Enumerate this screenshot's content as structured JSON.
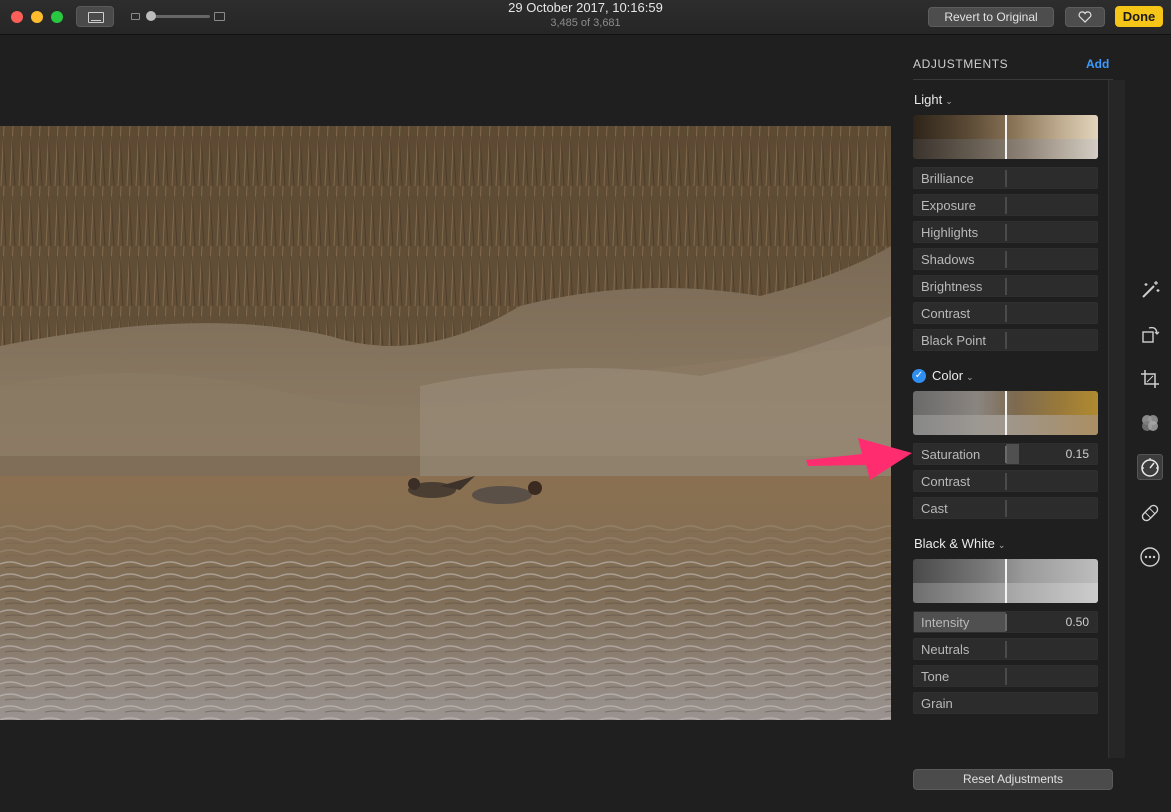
{
  "window": {
    "title_date": "29 October 2017, 10:16:59",
    "title_count": "3,485 of 3,681",
    "revert_label": "Revert to Original",
    "done_label": "Done",
    "favorite_icon": "heart-icon"
  },
  "adjustments": {
    "header": "ADJUSTMENTS",
    "add_label": "Add",
    "light": {
      "title": "Light",
      "sliders": [
        "Brilliance",
        "Exposure",
        "Highlights",
        "Shadows",
        "Brightness",
        "Contrast",
        "Black Point"
      ]
    },
    "color": {
      "title": "Color",
      "enabled": true,
      "saturation": {
        "label": "Saturation",
        "value": "0.15"
      },
      "contrast": "Contrast",
      "cast": "Cast"
    },
    "bw": {
      "title": "Black & White",
      "intensity": {
        "label": "Intensity",
        "value": "0.50"
      },
      "neutrals": "Neutrals",
      "tone": "Tone",
      "grain": "Grain"
    },
    "reset_label": "Reset Adjustments"
  },
  "tools": [
    "magic-wand-icon",
    "rotate-icon",
    "crop-icon",
    "filters-icon",
    "adjust-icon",
    "retouch-icon",
    "more-icon"
  ],
  "annotation": {
    "arrow_color": "#ff2d6f"
  },
  "colors": {
    "accent": "#3d9bff",
    "done": "#f5c518"
  }
}
